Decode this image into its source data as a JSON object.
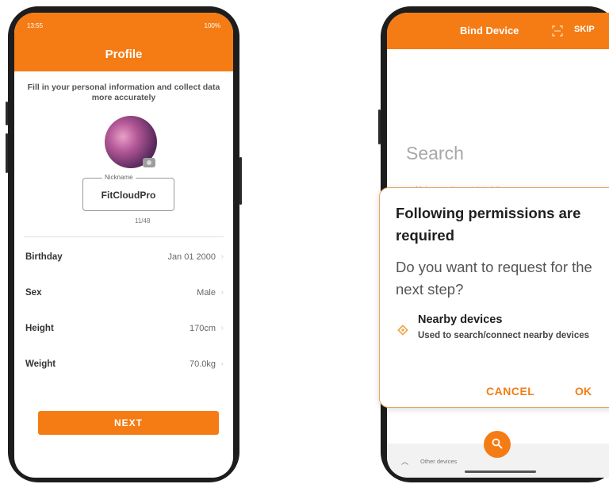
{
  "profile_screen": {
    "status_time": "13:55",
    "status_right": "100%",
    "title": "Profile",
    "intro": "Fill in your personal information and collect data more accurately",
    "nickname_label": "Nickname",
    "nickname_value": "FitCloudPro",
    "nickname_count": "11/48",
    "fields": [
      {
        "label": "Birthday",
        "value": "Jan 01 2000"
      },
      {
        "label": "Sex",
        "value": "Male"
      },
      {
        "label": "Height",
        "value": "170cm"
      },
      {
        "label": "Weight",
        "value": "70.0kg"
      }
    ],
    "next_label": "NEXT"
  },
  "bind_screen": {
    "title": "Bind Device",
    "skip_label": "SKIP",
    "search_label": "Search",
    "hint": "Make sure the watch is fully",
    "other_devices": "Other devices",
    "icons": {
      "scan": "scan-icon",
      "search": "search-icon",
      "expand": "chevron-up-icon"
    }
  },
  "permission_dialog": {
    "title": "Following permissions are required",
    "question": "Do you want to request for the next step?",
    "permission_name": "Nearby devices",
    "permission_desc": "Used to search/connect nearby devices",
    "cancel_label": "CANCEL",
    "ok_label": "OK"
  },
  "colors": {
    "accent": "#f57c14"
  }
}
